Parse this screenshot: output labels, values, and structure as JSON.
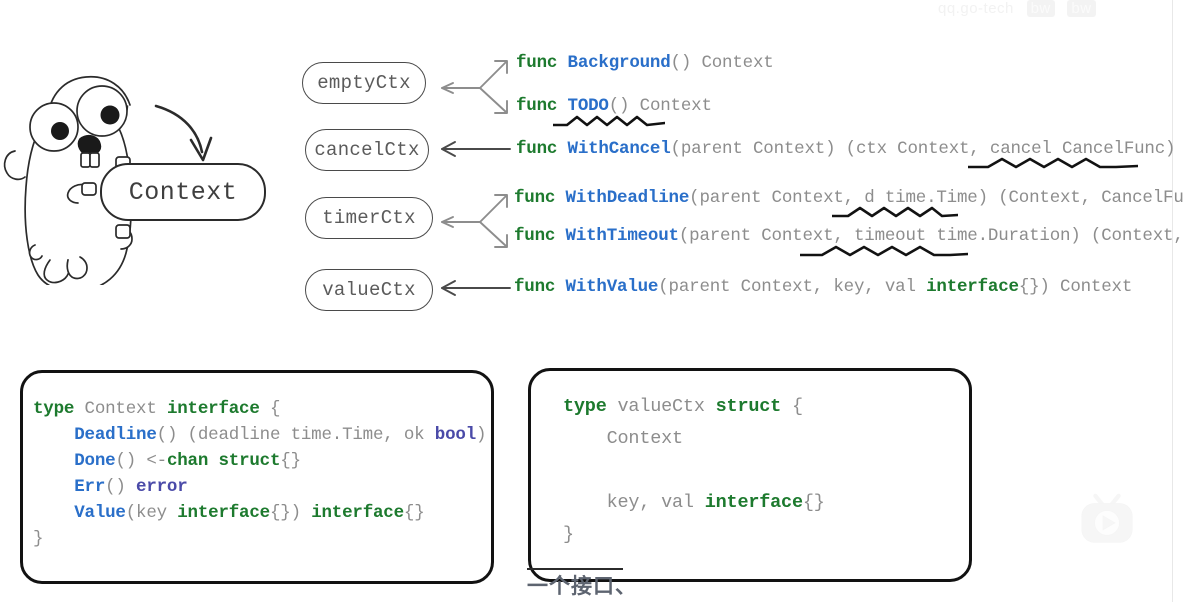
{
  "diagram": {
    "title_pill": "Context",
    "nodes": [
      {
        "id": "emptyCtx",
        "label": "emptyCtx"
      },
      {
        "id": "cancelCtx",
        "label": "cancelCtx"
      },
      {
        "id": "timerCtx",
        "label": "timerCtx"
      },
      {
        "id": "valueCtx",
        "label": "valueCtx"
      }
    ],
    "signatures": [
      {
        "id": "background",
        "text": "func Background() Context",
        "parts": [
          {
            "t": "func ",
            "c": "kw"
          },
          {
            "t": "Background",
            "c": "fn"
          },
          {
            "t": "() Context",
            "c": "pl"
          }
        ]
      },
      {
        "id": "todo",
        "text": "func TODO() Context",
        "parts": [
          {
            "t": "func ",
            "c": "kw"
          },
          {
            "t": "TODO",
            "c": "fn"
          },
          {
            "t": "() Context",
            "c": "pl"
          }
        ]
      },
      {
        "id": "withcancel",
        "text": "func WithCancel(parent Context) (ctx Context, cancel CancelFunc)",
        "parts": [
          {
            "t": "func ",
            "c": "kw"
          },
          {
            "t": "WithCancel",
            "c": "fn"
          },
          {
            "t": "(parent Context) (ctx Context, cancel CancelFunc)",
            "c": "pl"
          }
        ]
      },
      {
        "id": "withdeadline",
        "text": "func WithDeadline(parent Context, d time.Time) (Context, CancelFunc)",
        "parts": [
          {
            "t": "func ",
            "c": "kw"
          },
          {
            "t": "WithDeadline",
            "c": "fn"
          },
          {
            "t": "(parent Context, d time.Time) (Context, CancelFunc)",
            "c": "pl"
          }
        ]
      },
      {
        "id": "withtimeout",
        "text": "func WithTimeout(parent Context, timeout time.Duration) (Context, CancelFunc)",
        "parts": [
          {
            "t": "func ",
            "c": "kw"
          },
          {
            "t": "WithTimeout",
            "c": "fn"
          },
          {
            "t": "(parent Context, timeout time.Duration) (Context, CancelFunc)",
            "c": "pl"
          }
        ]
      },
      {
        "id": "withvalue",
        "text": "func WithValue(parent Context, key, val interface{}) Context",
        "parts": [
          {
            "t": "func ",
            "c": "kw"
          },
          {
            "t": "WithValue",
            "c": "fn"
          },
          {
            "t": "(parent Context, key, val ",
            "c": "pl"
          },
          {
            "t": "interface",
            "c": "iface"
          },
          {
            "t": "{}) Context",
            "c": "pl"
          }
        ]
      }
    ],
    "squiggly_underlined_terms": [
      "TODO",
      "cancel CancelFunc",
      "d time.Time",
      "timeout time.Duration"
    ]
  },
  "code_blocks": [
    {
      "id": "context-interface",
      "text": "type Context interface {\n    Deadline() (deadline time.Time, ok bool)\n    Done() <-chan struct{}\n    Err() error\n    Value(key interface{}) interface{}\n}",
      "lines": [
        [
          {
            "t": "type ",
            "c": "kw"
          },
          {
            "t": "Context ",
            "c": "pl"
          },
          {
            "t": "interface",
            "c": "kw"
          },
          {
            "t": " {",
            "c": "pl"
          }
        ],
        [
          {
            "t": "    ",
            "c": "pl"
          },
          {
            "t": "Deadline",
            "c": "fn"
          },
          {
            "t": "() (deadline time.Time, ok ",
            "c": "pl"
          },
          {
            "t": "bool",
            "c": "typ"
          },
          {
            "t": ")",
            "c": "pl"
          }
        ],
        [
          {
            "t": "    ",
            "c": "pl"
          },
          {
            "t": "Done",
            "c": "fn"
          },
          {
            "t": "() <-",
            "c": "pl"
          },
          {
            "t": "chan struct",
            "c": "kw"
          },
          {
            "t": "{}",
            "c": "pl"
          }
        ],
        [
          {
            "t": "    ",
            "c": "pl"
          },
          {
            "t": "Err",
            "c": "fn"
          },
          {
            "t": "() ",
            "c": "pl"
          },
          {
            "t": "error",
            "c": "typ"
          }
        ],
        [
          {
            "t": "    ",
            "c": "pl"
          },
          {
            "t": "Value",
            "c": "fn"
          },
          {
            "t": "(key ",
            "c": "pl"
          },
          {
            "t": "interface",
            "c": "kw"
          },
          {
            "t": "{}) ",
            "c": "pl"
          },
          {
            "t": "interface",
            "c": "kw"
          },
          {
            "t": "{}",
            "c": "pl"
          }
        ],
        [
          {
            "t": "}",
            "c": "pl"
          }
        ]
      ]
    },
    {
      "id": "valuectx-struct",
      "text": "type valueCtx struct {\n    Context\n\n    key, val interface{}\n}",
      "lines": [
        [
          {
            "t": "type ",
            "c": "kw"
          },
          {
            "t": "valueCtx ",
            "c": "pl"
          },
          {
            "t": "struct",
            "c": "kw"
          },
          {
            "t": " {",
            "c": "pl"
          }
        ],
        [
          {
            "t": "    Context",
            "c": "pl"
          }
        ],
        [
          {
            "t": " ",
            "c": "pl"
          }
        ],
        [
          {
            "t": "    key, val ",
            "c": "pl"
          },
          {
            "t": "interface",
            "c": "kw"
          },
          {
            "t": "{}",
            "c": "pl"
          }
        ],
        [
          {
            "t": "}",
            "c": "pl"
          }
        ]
      ]
    }
  ],
  "annotations": {
    "chinese_note": "一个接口、"
  },
  "watermarks": {
    "top_text": "qq.go-tech",
    "top_badge_1": "bw",
    "top_badge_2": "bw",
    "logo_name": "bilibili-tv-logo"
  },
  "colors": {
    "keyword_green": "#1d7a2e",
    "func_blue": "#2a6fc9",
    "type_purple": "#4a4aa8",
    "plain_gray": "#8d8d8d",
    "box_border": "#121212",
    "background": "#ffffff"
  }
}
